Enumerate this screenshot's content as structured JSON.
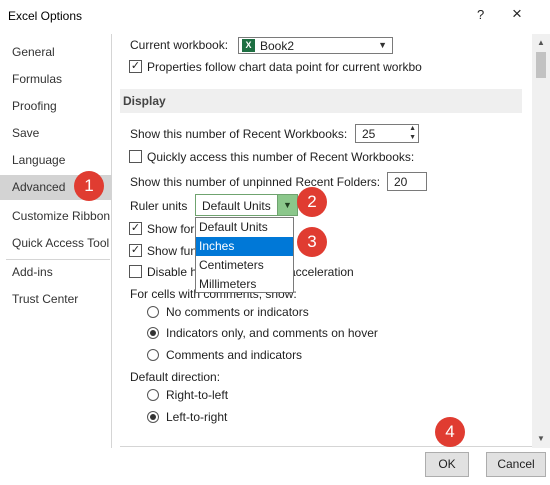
{
  "window": {
    "title": "Excel Options",
    "help_glyph": "?",
    "close_glyph": "×"
  },
  "sidebar": {
    "items": [
      {
        "label": "General"
      },
      {
        "label": "Formulas"
      },
      {
        "label": "Proofing"
      },
      {
        "label": "Save"
      },
      {
        "label": "Language"
      },
      {
        "label": "Advanced",
        "selected": true
      },
      {
        "label": "Customize Ribbon"
      },
      {
        "label": "Quick Access Tool"
      },
      {
        "label": "Add-ins"
      },
      {
        "label": "Trust Center"
      }
    ]
  },
  "content": {
    "current_workbook_label": "Current workbook:",
    "current_workbook_value": "Book2",
    "properties_follow_label": "Properties follow chart data point for current workbo",
    "properties_follow_checked": true,
    "display_header": "Display",
    "recent_workbooks_label": "Show this number of Recent Workbooks:",
    "recent_workbooks_value": "25",
    "quick_access_label": "Quickly access this number of Recent Workbooks:",
    "quick_access_checked": false,
    "unpinned_folders_label": "Show this number of unpinned Recent Folders:",
    "unpinned_folders_value": "20",
    "ruler_units_label": "Ruler units",
    "ruler_units_value": "Default Units",
    "ruler_units_options": [
      "Default Units",
      "Inches",
      "Centimeters",
      "Millimeters"
    ],
    "ruler_units_highlighted": "Inches",
    "show_formula_bar_label": "Show for",
    "show_formula_bar_checked": true,
    "show_function_label": "Show fun",
    "show_function_checked": true,
    "disable_hw_label_start": "Disable h",
    "disable_hw_label_end": "acceleration",
    "disable_hw_checked": false,
    "comments_label": "For cells with comments, show:",
    "comments_options": [
      {
        "label": "No comments or indicators",
        "selected": false
      },
      {
        "label": "Indicators only, and comments on hover",
        "selected": true
      },
      {
        "label": "Comments and indicators",
        "selected": false
      }
    ],
    "direction_label": "Default direction:",
    "direction_options": [
      {
        "label": "Right-to-left",
        "selected": false
      },
      {
        "label": "Left-to-right",
        "selected": true
      }
    ]
  },
  "footer": {
    "ok_label": "OK",
    "cancel_label": "Cancel"
  },
  "callouts": [
    "1",
    "2",
    "3",
    "4"
  ],
  "colors": {
    "callout": "#e03c31",
    "highlight": "#0078d7",
    "dropdown_button": "#8bc78b",
    "sidebar_selected": "#d3d3d3"
  }
}
